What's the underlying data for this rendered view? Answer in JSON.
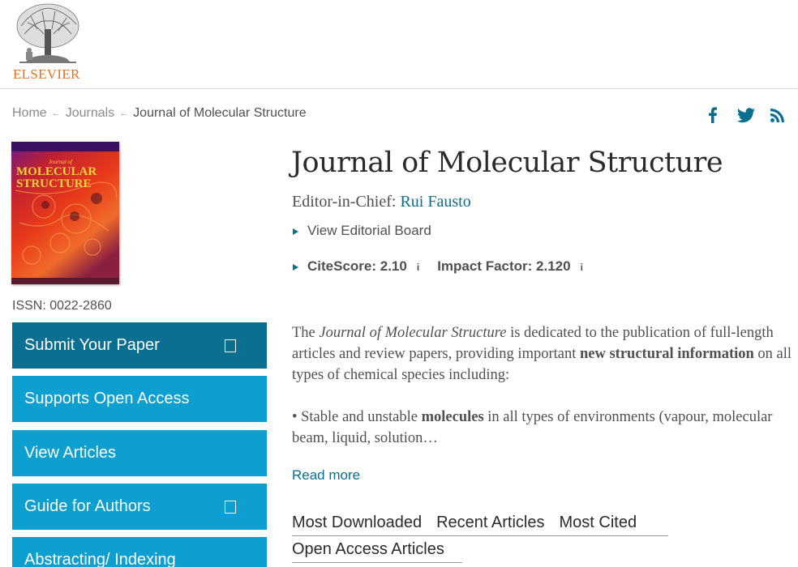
{
  "brand": {
    "name": "ELSEVIER",
    "color": "#e9711c"
  },
  "breadcrumb": {
    "home": "Home",
    "journals": "Journals",
    "current": "Journal of Molecular Structure"
  },
  "social": {
    "icons": [
      "facebook-icon",
      "twitter-icon",
      "rss-icon"
    ],
    "color": "#0b6e8f"
  },
  "cover": {
    "line1": "MOLECULAR",
    "line2": "STRUCTURE"
  },
  "issn": "ISSN: 0022-2860",
  "nav": {
    "items": [
      {
        "label": "Submit Your Paper",
        "external": true
      },
      {
        "label": "Supports Open Access",
        "external": false
      },
      {
        "label": "View Articles",
        "external": false
      },
      {
        "label": "Guide for Authors",
        "external": true
      },
      {
        "label": "Abstracting/ Indexing",
        "external": false
      }
    ],
    "color_primary": "#0c9fd0",
    "color_dark": "#0a6f91"
  },
  "journal": {
    "title": "Journal of Molecular Structure",
    "editor_label": "Editor-in-Chief: ",
    "editor_name": "Rui Fausto",
    "editorial_board": "View Editorial Board",
    "citescore": "CiteScore: 2.10",
    "impact_factor": "Impact Factor: 2.120",
    "info_symbol": "i"
  },
  "description": {
    "p1_pre": "The ",
    "p1_journal": "Journal of Molecular Structure",
    "p1_mid": " is dedicated to the publication of full-length articles and review papers, providing important ",
    "p1_bold": "new structural information",
    "p1_post": " on all types of chemical species including:",
    "p2_pre": "• Stable and unstable ",
    "p2_bold": "molecules",
    "p2_post": " in all types of environments (vapour, molecular beam, liquid, solution…",
    "read_more": "Read more"
  },
  "tabs": {
    "most_downloaded": "Most Downloaded",
    "recent_articles": "Recent Articles",
    "most_cited": "Most Cited",
    "open_access": "Open Access Articles"
  }
}
